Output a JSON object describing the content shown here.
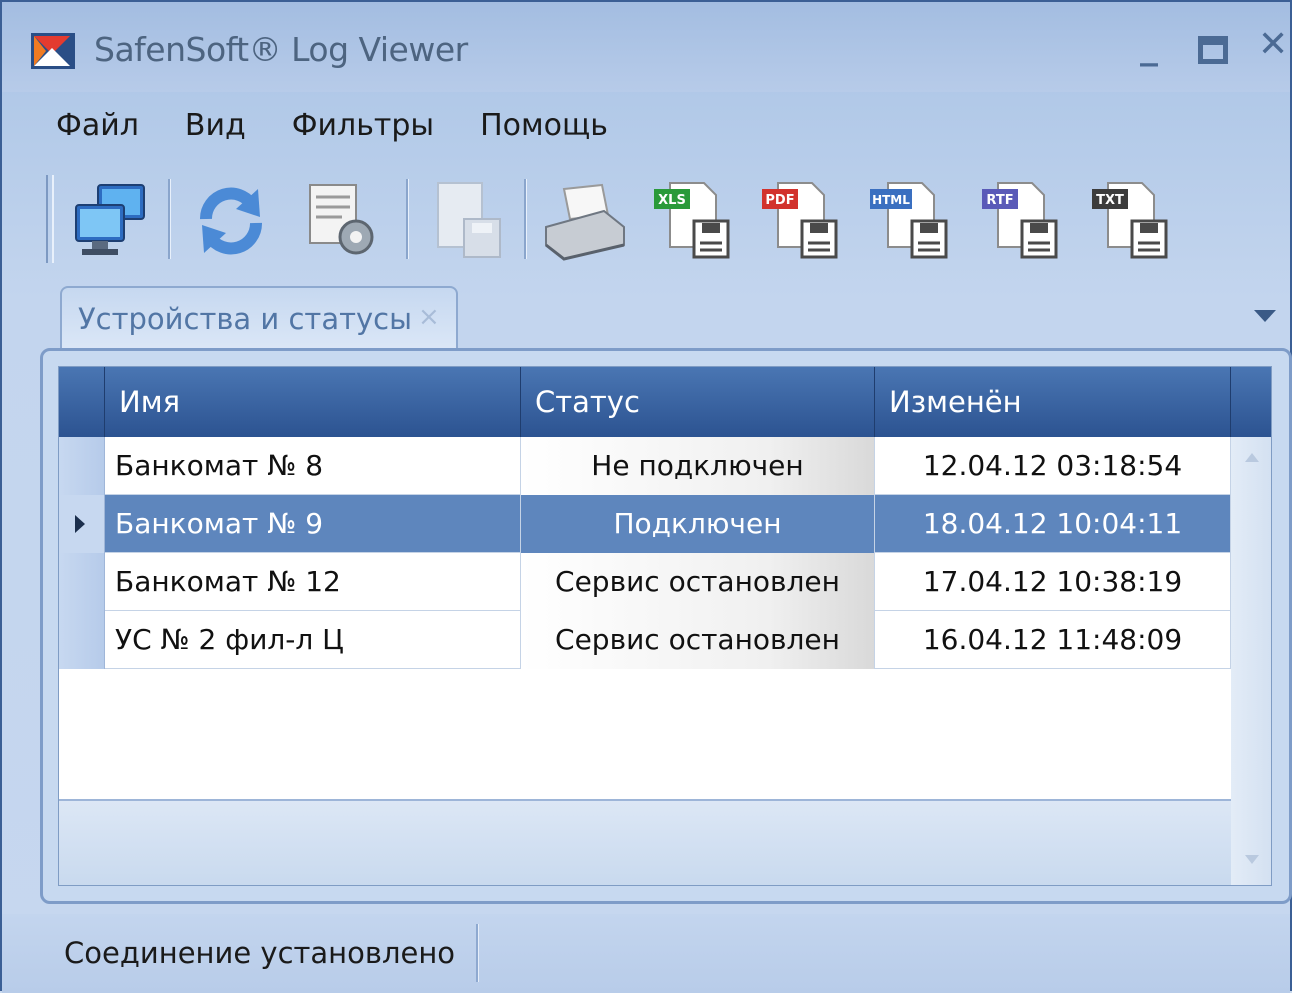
{
  "window": {
    "title": "SafenSoft® Log Viewer",
    "controls": {
      "minimize": "_",
      "close": "✕"
    }
  },
  "menu": [
    "Файл",
    "Вид",
    "Фильтры",
    "Помощь"
  ],
  "toolbar": {
    "buttons": [
      {
        "name": "connect-computers-icon"
      },
      {
        "name": "refresh-icon"
      },
      {
        "name": "settings-document-icon"
      },
      {
        "name": "save-disabled-icon"
      },
      {
        "name": "print-icon"
      },
      {
        "name": "export-xls-icon",
        "badge": "XLS",
        "color": "#2a9a3a"
      },
      {
        "name": "export-pdf-icon",
        "badge": "PDF",
        "color": "#d2322d"
      },
      {
        "name": "export-html-icon",
        "badge": "HTML",
        "color": "#3a6fc0"
      },
      {
        "name": "export-rtf-icon",
        "badge": "RTF",
        "color": "#5a5ab8"
      },
      {
        "name": "export-txt-icon",
        "badge": "TXT",
        "color": "#3c3c3c"
      }
    ]
  },
  "tab": {
    "label": "Устройства и статусы",
    "close": "×"
  },
  "grid": {
    "columns": [
      "Имя",
      "Статус",
      "Изменён"
    ],
    "rows": [
      {
        "name": "Банкомат № 8",
        "status": "Не подключен",
        "changed": "12.04.12 03:18:54",
        "selected": false
      },
      {
        "name": "Банкомат № 9",
        "status": "Подключен",
        "changed": "18.04.12 10:04:11",
        "selected": true
      },
      {
        "name": "Банкомат № 12",
        "status": "Сервис остановлен",
        "changed": "17.04.12 10:38:19",
        "selected": false
      },
      {
        "name": "УС № 2 фил-л Ц",
        "status": "Сервис остановлен",
        "changed": "16.04.12 11:48:09",
        "selected": false
      }
    ]
  },
  "statusbar": {
    "text": "Соединение установлено"
  },
  "colors": {
    "header": "#2c5391",
    "selected_row": "#5e86bd",
    "frame": "#3b5f95"
  }
}
